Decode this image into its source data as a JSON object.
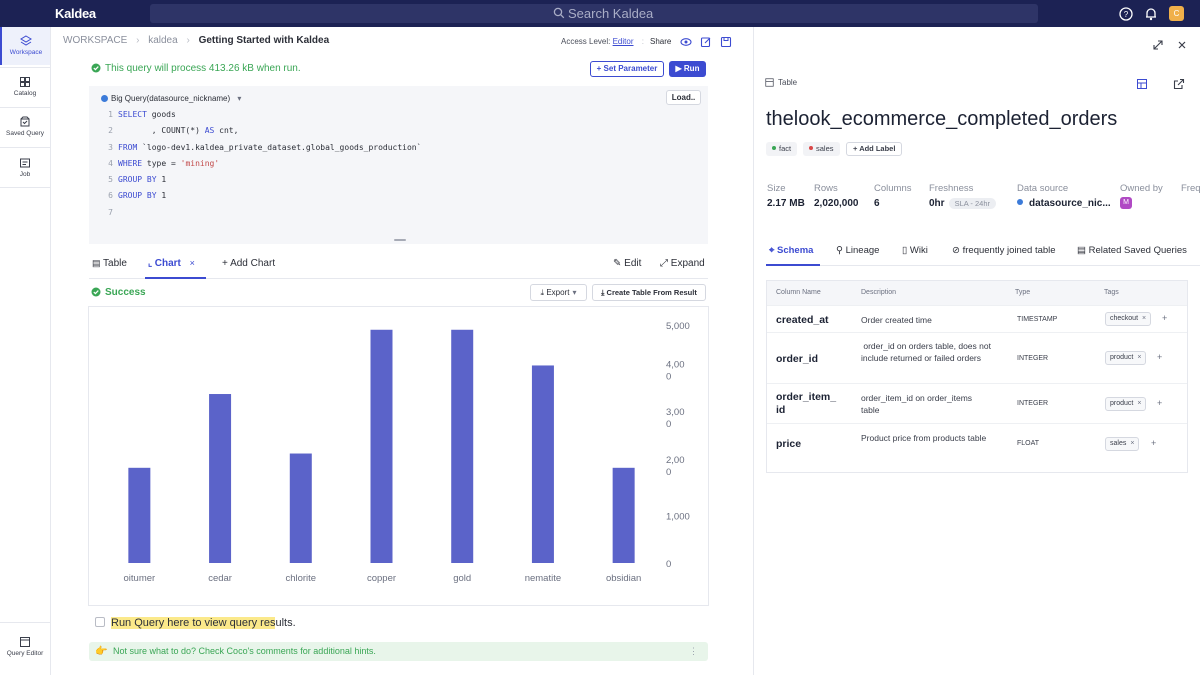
{
  "topbar": {
    "logo": "Kaldea",
    "search_placeholder": "Search Kaldea",
    "avatar_initial": "C"
  },
  "leftnav": {
    "items": [
      {
        "label": "Workspace",
        "icon": "workspace-icon",
        "active": true
      },
      {
        "label": "Catalog",
        "icon": "catalog-icon"
      },
      {
        "label": "Saved Query",
        "icon": "saved-query-icon"
      },
      {
        "label": "Job",
        "icon": "job-icon"
      }
    ],
    "bottom": {
      "label": "Query Editor",
      "icon": "query-editor-icon"
    }
  },
  "breadcrumb": {
    "items": [
      "WORKSPACE",
      "kaldea"
    ],
    "current": "Getting Started with Kaldea"
  },
  "header": {
    "access_label": "Access Level:",
    "access_value": "Editor",
    "share": "Share"
  },
  "query": {
    "notice": "This query will process 413.26 kB when run.",
    "set_parameter": "Set Parameter",
    "run": "Run",
    "source": "Big Query(datasource_nickname)",
    "load": "Load..",
    "lines": [
      {
        "n": "1",
        "parts": [
          {
            "t": "SELECT",
            "c": "kw"
          },
          {
            "t": " goods",
            "c": ""
          }
        ]
      },
      {
        "n": "2",
        "parts": [
          {
            "t": "       , COUNT(*) ",
            "c": ""
          },
          {
            "t": "AS",
            "c": "kw"
          },
          {
            "t": " cnt,",
            "c": ""
          }
        ]
      },
      {
        "n": "3",
        "parts": [
          {
            "t": "FROM",
            "c": "kw"
          },
          {
            "t": " `logo-dev1.kaldea_private_dataset.global_goods_production`",
            "c": ""
          }
        ]
      },
      {
        "n": "4",
        "parts": [
          {
            "t": "WHERE",
            "c": "kw"
          },
          {
            "t": " type = ",
            "c": ""
          },
          {
            "t": "'mining'",
            "c": "str"
          }
        ]
      },
      {
        "n": "5",
        "parts": [
          {
            "t": "GROUP BY",
            "c": "kw"
          },
          {
            "t": " 1",
            "c": ""
          }
        ]
      },
      {
        "n": "6",
        "parts": [
          {
            "t": "GROUP BY",
            "c": "kw"
          },
          {
            "t": " 1",
            "c": ""
          }
        ]
      },
      {
        "n": "7",
        "parts": []
      }
    ]
  },
  "result_tabs": {
    "table": "Table",
    "chart": "Chart",
    "add_chart": "Add Chart",
    "edit": "Edit",
    "expand": "Expand"
  },
  "result": {
    "status": "Success",
    "export": "Export",
    "create_table": "Create Table From Result"
  },
  "chart_data": {
    "type": "bar",
    "categories": [
      "bitumen",
      "cedar",
      "chlorite",
      "copper",
      "gold",
      "hematite",
      "obsidian"
    ],
    "category_labels": [
      "oitumer",
      "cedar",
      "chlorite",
      "copper",
      "gold",
      "nematite",
      "obsidian"
    ],
    "values": [
      2000,
      3550,
      2300,
      4900,
      4900,
      4150,
      2000
    ],
    "ylim": [
      0,
      5000
    ],
    "yticks": [
      0,
      1000,
      2000,
      3000,
      4000,
      5000
    ],
    "ytick_lines": [
      [
        "0"
      ],
      [
        "1,000"
      ],
      [
        "2,00",
        "0"
      ],
      [
        "3,00",
        "0"
      ],
      [
        "4,00",
        "0"
      ],
      [
        "5,000"
      ]
    ],
    "color": "#5b63c9",
    "grid": false,
    "legend": "none"
  },
  "footer": {
    "runquery_highlight": "Run Query here to view query res",
    "runquery_rest": "ults.",
    "hint": "Not sure what to do? Check Coco's comments for additional hints."
  },
  "panel": {
    "type": "Table",
    "title": "thelook_ecommerce_completed_orders",
    "labels": [
      {
        "text": "fact",
        "color": "#3aa655"
      },
      {
        "text": "sales",
        "color": "#d94848"
      }
    ],
    "add_label": "Add Label",
    "meta": [
      {
        "label": "Size",
        "value": "2.17 MB"
      },
      {
        "label": "Rows",
        "value": "2,020,000"
      },
      {
        "label": "Columns",
        "value": "6"
      },
      {
        "label": "Freshness",
        "value": "0hr",
        "badge": "SLA - 24hr"
      },
      {
        "label": "Data source",
        "value": "datasource_nic..."
      },
      {
        "label": "Owned by",
        "value": "M"
      },
      {
        "label": "Freq",
        "value": ""
      }
    ],
    "tabs": [
      "Schema",
      "Lineage",
      "Wiki",
      "frequently joined table",
      "Related Saved Queries"
    ],
    "schema_headers": [
      "Column Name",
      "Description",
      "Type",
      "Tags"
    ],
    "schema_rows": [
      {
        "name": "created_at",
        "desc": "Order created time",
        "type": "TIMESTAMP",
        "tag": "checkout"
      },
      {
        "name": "order_id",
        "desc": " order_id on orders table, does not include returned or failed orders",
        "type": "INTEGER",
        "tag": "product"
      },
      {
        "name": "order_item_ id",
        "desc": "order_item_id on order_items table",
        "type": "INTEGER",
        "tag": "product"
      },
      {
        "name": "price",
        "desc": "Product price from products table",
        "type": "FLOAT",
        "tag": "sales"
      }
    ]
  }
}
